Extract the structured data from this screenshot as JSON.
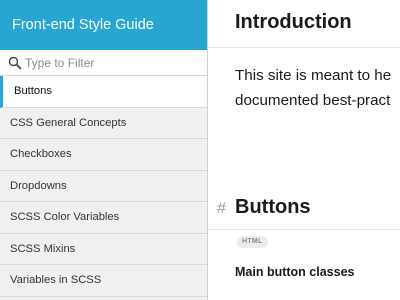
{
  "sidebar": {
    "title": "Front-end Style Guide",
    "filter": {
      "placeholder": "Type to Filter",
      "value": ""
    },
    "items": [
      {
        "label": "Buttons",
        "active": true
      },
      {
        "label": "CSS General Concepts",
        "active": false
      },
      {
        "label": "Checkboxes",
        "active": false
      },
      {
        "label": "Dropdowns",
        "active": false
      },
      {
        "label": "SCSS Color Variables",
        "active": false
      },
      {
        "label": "SCSS Mixins",
        "active": false
      },
      {
        "label": "Variables in SCSS",
        "active": false
      }
    ]
  },
  "main": {
    "title": "Introduction",
    "intro_line1": "This site is meant to he",
    "intro_line2": "documented best-pract",
    "section": {
      "anchor": "#",
      "title": "Buttons",
      "badge": "HTML",
      "subtitle": "Main button classes"
    }
  },
  "colors": {
    "accent": "#26a6d1",
    "sidebar_bg": "#f0f0f0",
    "text": "#1a1a1a"
  }
}
